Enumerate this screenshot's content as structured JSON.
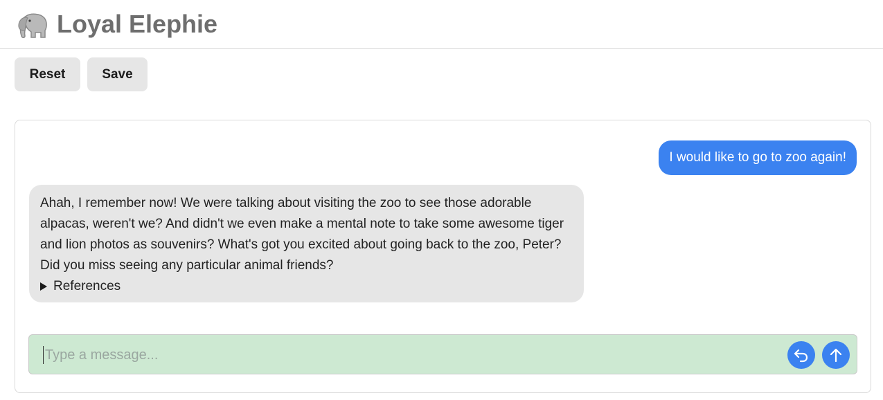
{
  "header": {
    "title": "Loyal Elephie",
    "logo_icon": "elephant-icon"
  },
  "toolbar": {
    "reset_label": "Reset",
    "save_label": "Save"
  },
  "chat": {
    "messages": [
      {
        "role": "user",
        "text": "I would like to go to zoo again!"
      },
      {
        "role": "assistant",
        "text": "Ahah, I remember now! We were talking about visiting the zoo to see those adorable alpacas, weren't we? And didn't we even make a mental note to take some awesome tiger and lion photos as souvenirs? What's got you excited about going back to the zoo, Peter? Did you miss seeing any particular animal friends?",
        "references_label": "References"
      }
    ]
  },
  "composer": {
    "placeholder": "Type a message...",
    "value": "",
    "undo_icon": "undo-arrow-icon",
    "send_icon": "arrow-up-icon"
  },
  "colors": {
    "user_bubble": "#3b82f0",
    "assistant_bubble": "#e6e6e6",
    "input_background": "#cde9d2",
    "title": "#6e6e6e"
  }
}
